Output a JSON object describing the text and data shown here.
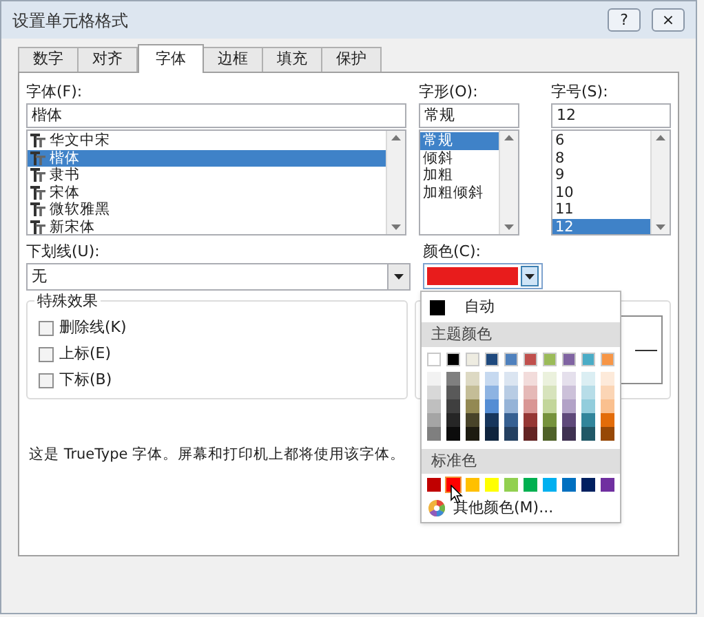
{
  "window": {
    "title": "设置单元格格式",
    "buttons": [
      "?",
      "×"
    ]
  },
  "tabs": [
    {
      "label": "数字",
      "selected": false
    },
    {
      "label": "对齐",
      "selected": false
    },
    {
      "label": "字体",
      "selected": true
    },
    {
      "label": "边框",
      "selected": false
    },
    {
      "label": "填充",
      "selected": false
    },
    {
      "label": "保护",
      "selected": false
    }
  ],
  "font": {
    "label": "字体(F):",
    "value": "楷体",
    "items": [
      {
        "label": "华文中宋",
        "selected": false
      },
      {
        "label": "楷体",
        "selected": true
      },
      {
        "label": "隶书",
        "selected": false
      },
      {
        "label": "宋体",
        "selected": false
      },
      {
        "label": "微软雅黑",
        "selected": false
      },
      {
        "label": "新宋体",
        "selected": false
      }
    ]
  },
  "style": {
    "label": "字形(O):",
    "value": "常规",
    "items": [
      {
        "label": "常规",
        "selected": true
      },
      {
        "label": "倾斜",
        "selected": false
      },
      {
        "label": "加粗",
        "selected": false
      },
      {
        "label": "加粗倾斜",
        "selected": false
      }
    ]
  },
  "size": {
    "label": "字号(S):",
    "value": "12",
    "items": [
      {
        "label": "6",
        "selected": false
      },
      {
        "label": "8",
        "selected": false
      },
      {
        "label": "9",
        "selected": false
      },
      {
        "label": "10",
        "selected": false
      },
      {
        "label": "11",
        "selected": false
      },
      {
        "label": "12",
        "selected": true
      }
    ]
  },
  "underline": {
    "label": "下划线(U):",
    "value": "无"
  },
  "color": {
    "label": "颜色(C):",
    "color": "#e81c1c"
  },
  "effects": {
    "title": "特殊效果",
    "items": [
      {
        "label": "删除线(K)",
        "checked": false
      },
      {
        "label": "上标(E)",
        "checked": false
      },
      {
        "label": "下标(B)",
        "checked": false
      }
    ]
  },
  "note": "这是 TrueType 字体。屏幕和打印机上都将使用该字体。",
  "color_menu": {
    "automatic": {
      "label": "自动",
      "color": "#000000"
    },
    "theme_title": "主题颜色",
    "theme": [
      {
        "color": "#ffffff",
        "shades": [
          {
            "color": "#f2f2f2"
          },
          {
            "color": "#d8d8d8"
          },
          {
            "color": "#bfbfbf"
          },
          {
            "color": "#a5a5a5"
          },
          {
            "color": "#7f7f7f"
          }
        ]
      },
      {
        "color": "#000000",
        "shades": [
          {
            "color": "#7f7f7f"
          },
          {
            "color": "#595959"
          },
          {
            "color": "#3f3f3f"
          },
          {
            "color": "#262626"
          },
          {
            "color": "#0c0c0c"
          }
        ]
      },
      {
        "color": "#eeece1",
        "shades": [
          {
            "color": "#ddd9c3"
          },
          {
            "color": "#c4bd97"
          },
          {
            "color": "#938953"
          },
          {
            "color": "#494429"
          },
          {
            "color": "#1d1b10"
          }
        ]
      },
      {
        "color": "#1f497d",
        "shades": [
          {
            "color": "#c6d9f0"
          },
          {
            "color": "#8db3e2"
          },
          {
            "color": "#548dd4"
          },
          {
            "color": "#17365d"
          },
          {
            "color": "#0f243e"
          }
        ]
      },
      {
        "color": "#4f81bd",
        "shades": [
          {
            "color": "#dbe5f1"
          },
          {
            "color": "#b8cce4"
          },
          {
            "color": "#95b3d7"
          },
          {
            "color": "#366092"
          },
          {
            "color": "#244061"
          }
        ]
      },
      {
        "color": "#c0504d",
        "shades": [
          {
            "color": "#f2dcdb"
          },
          {
            "color": "#e5b9b7"
          },
          {
            "color": "#d99694"
          },
          {
            "color": "#953734"
          },
          {
            "color": "#632423"
          }
        ]
      },
      {
        "color": "#9bbb59",
        "shades": [
          {
            "color": "#ebf1dd"
          },
          {
            "color": "#d7e3bc"
          },
          {
            "color": "#c3d69b"
          },
          {
            "color": "#76923c"
          },
          {
            "color": "#4f6128"
          }
        ]
      },
      {
        "color": "#8064a2",
        "shades": [
          {
            "color": "#e5e0ec"
          },
          {
            "color": "#ccc1d9"
          },
          {
            "color": "#b2a2c7"
          },
          {
            "color": "#5f497a"
          },
          {
            "color": "#3f3151"
          }
        ]
      },
      {
        "color": "#4bacc6",
        "shades": [
          {
            "color": "#dbeef3"
          },
          {
            "color": "#b7dde8"
          },
          {
            "color": "#92cddc"
          },
          {
            "color": "#31859b"
          },
          {
            "color": "#205867"
          }
        ]
      },
      {
        "color": "#f79646",
        "shades": [
          {
            "color": "#fdeada"
          },
          {
            "color": "#fbd5b5"
          },
          {
            "color": "#fac08f"
          },
          {
            "color": "#e36c09"
          },
          {
            "color": "#974806"
          }
        ]
      }
    ],
    "standard_title": "标准色",
    "standard": [
      {
        "color": "#c00000",
        "selected": false
      },
      {
        "color": "#ff0000",
        "selected": true
      },
      {
        "color": "#ffc000",
        "selected": false
      },
      {
        "color": "#ffff00",
        "selected": false
      },
      {
        "color": "#92d050",
        "selected": false
      },
      {
        "color": "#00b050",
        "selected": false
      },
      {
        "color": "#00b0f0",
        "selected": false
      },
      {
        "color": "#0070c0",
        "selected": false
      },
      {
        "color": "#002060",
        "selected": false
      },
      {
        "color": "#7030a0",
        "selected": false
      }
    ],
    "more": "其他颜色(M)..."
  }
}
